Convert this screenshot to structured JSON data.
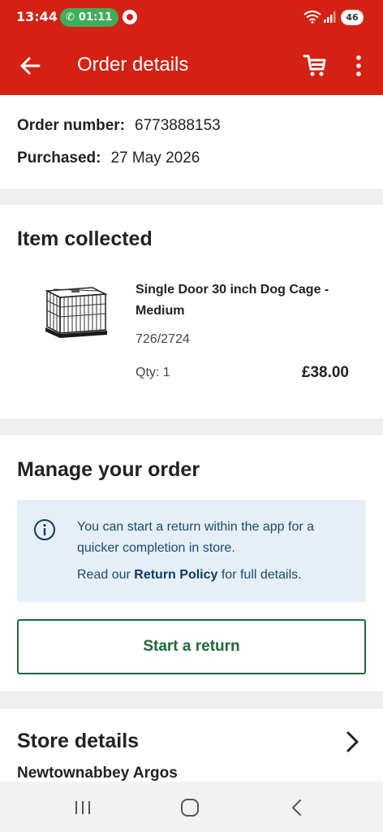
{
  "status_bar": {
    "time": "13:44",
    "call_duration": "01:11",
    "battery": "46"
  },
  "app_bar": {
    "title": "Order details"
  },
  "order": {
    "number_label": "Order number:",
    "number_value": "6773888153",
    "purchased_label": "Purchased:",
    "purchased_value": "27 May 2026"
  },
  "items": {
    "title": "Item collected",
    "product": {
      "name": "Single Door 30 inch Dog Cage - Medium",
      "code": "726/2724",
      "qty": "Qty: 1",
      "price": "£38.00"
    }
  },
  "manage": {
    "title": "Manage your order",
    "info_text": "You can start a return within the app for a quicker completion in store.",
    "info_prefix": "Read our ",
    "info_link": "Return Policy",
    "info_suffix": " for full details.",
    "return_button": "Start a return"
  },
  "store": {
    "title": "Store details",
    "name": "Newtownabbey Argos"
  },
  "colors": {
    "brand_red": "#d42114",
    "call_green": "#3fae5a",
    "button_green": "#1e6a3a",
    "info_bg": "#e6eff8"
  }
}
